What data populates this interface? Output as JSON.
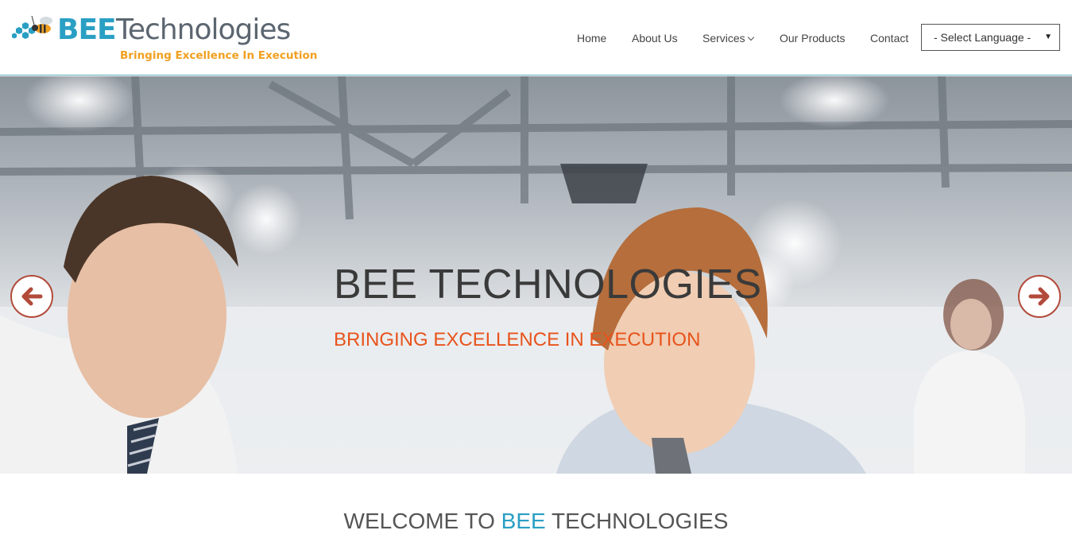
{
  "header": {
    "logo": {
      "brand_bee": "BEE",
      "brand_rest": "Technologies",
      "tagline": "Bringing Excellence In Execution"
    },
    "nav": {
      "home": "Home",
      "about": "About Us",
      "services": "Services",
      "products": "Our Products",
      "contact": "Contact"
    },
    "language_select": {
      "selected": "- Select Language -",
      "arrow": "▼"
    }
  },
  "hero": {
    "title": "BEE TECHNOLOGIES",
    "subtitle": "BRINGING EXCELLENCE IN EXECUTION",
    "prev_icon": "arrow-left-icon",
    "next_icon": "arrow-right-icon"
  },
  "welcome": {
    "prefix": "WELCOME TO ",
    "accent": "BEE",
    "suffix": " TECHNOLOGIES"
  },
  "colors": {
    "brand_blue": "#2a9fc4",
    "brand_orange": "#f0a020",
    "hero_subtitle": "#e8531c",
    "arrow_accent": "#b24a3a"
  }
}
